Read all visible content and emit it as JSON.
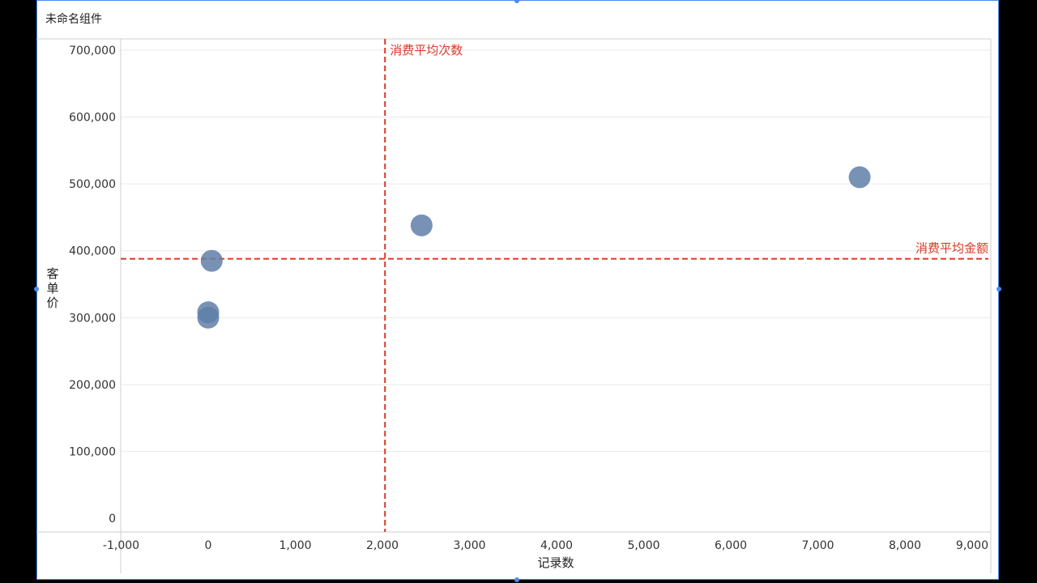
{
  "widget": {
    "title": "未命名组件"
  },
  "colors": {
    "point": "#5f7fa8",
    "point_dark": "#3f5f8a",
    "ref_line": "#d93a26",
    "grid": "#e9e9e9"
  },
  "chart_data": {
    "type": "scatter",
    "xlabel": "记录数",
    "ylabel": "客单价",
    "xlim": [
      -1000,
      9000
    ],
    "ylim": [
      0,
      700000
    ],
    "x_ticks": [
      "-1,000",
      "0",
      "1,000",
      "2,000",
      "3,000",
      "4,000",
      "5,000",
      "6,000",
      "7,000",
      "8,000",
      "9,000"
    ],
    "y_ticks": [
      "0",
      "100,000",
      "200,000",
      "300,000",
      "400,000",
      "500,000",
      "600,000",
      "700,000"
    ],
    "grid": "horizontal",
    "points": [
      {
        "x": 40,
        "y": 385000
      },
      {
        "x": 0,
        "y": 300000
      },
      {
        "x": 0,
        "y": 308000
      },
      {
        "x": 2450,
        "y": 438000
      },
      {
        "x": 7480,
        "y": 510000
      }
    ],
    "reference_lines": [
      {
        "axis": "x",
        "value": 2030,
        "label": "消费平均次数"
      },
      {
        "axis": "y",
        "value": 388000,
        "label": "消费平均金额"
      }
    ]
  }
}
